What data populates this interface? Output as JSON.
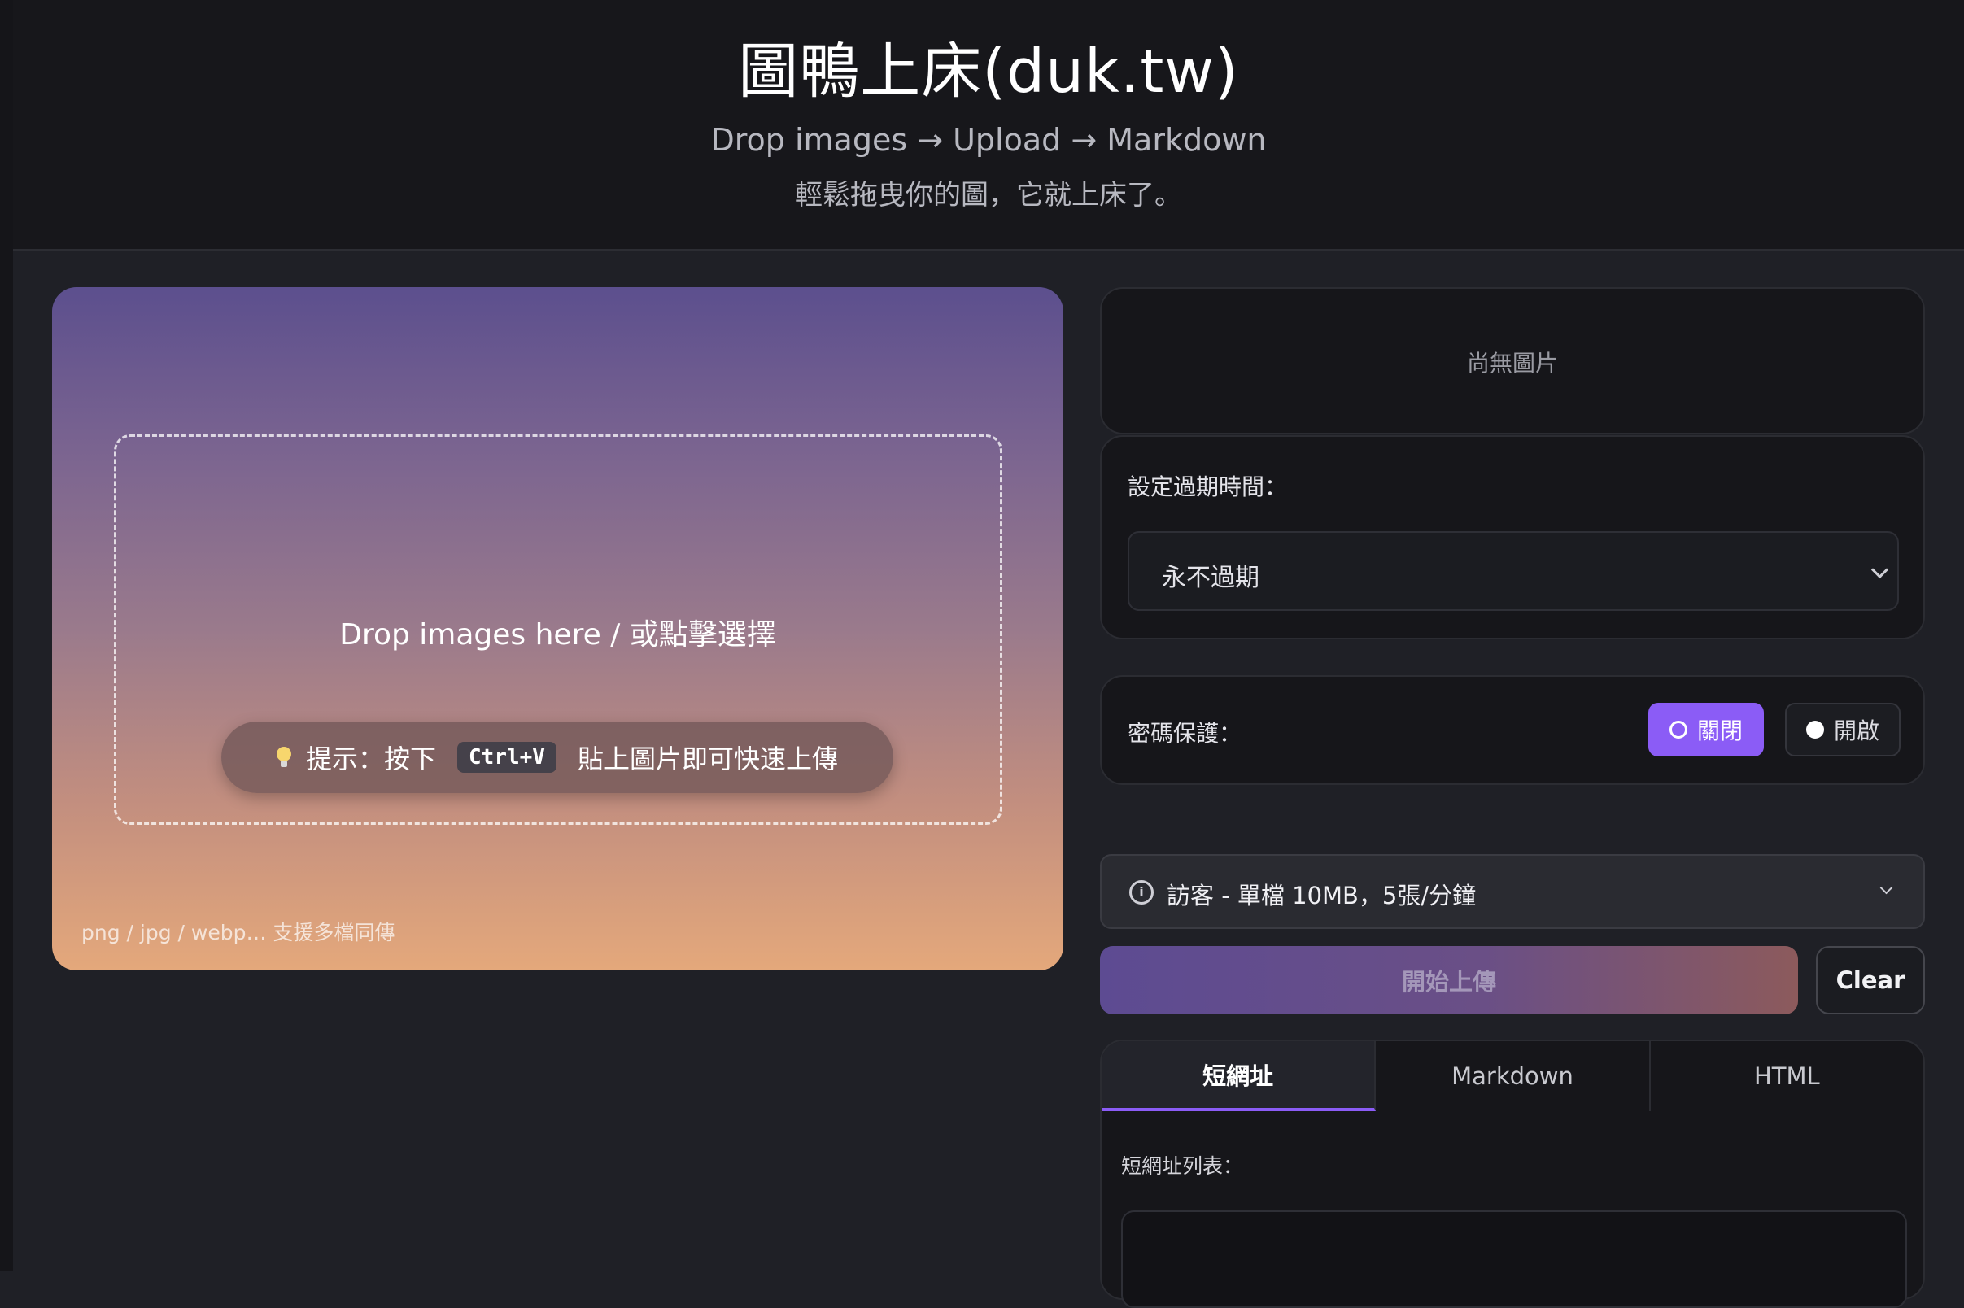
{
  "header": {
    "title": "圖鴨上床(duk.tw)",
    "subtitle": "Drop images → Upload → Markdown",
    "tagline": "輕鬆拖曳你的圖，它就上床了。"
  },
  "dropzone": {
    "main_text": "Drop images here / 或點擊選擇",
    "hint_prefix": "提示：按下",
    "hint_key": "Ctrl+V",
    "hint_suffix": "貼上圖片即可快速上傳",
    "formats": "png / jpg / webp… 支援多檔同傳"
  },
  "preview": {
    "empty_text": "尚無圖片"
  },
  "expiry": {
    "label": "設定過期時間：",
    "selected": "永不過期"
  },
  "password": {
    "label": "密碼保護：",
    "off_label": "關閉",
    "on_label": "開啟"
  },
  "quota": {
    "text": "訪客 - 單檔 10MB，5張/分鐘"
  },
  "actions": {
    "upload_label": "開始上傳",
    "clear_label": "Clear"
  },
  "output": {
    "tabs": [
      "短網址",
      "Markdown",
      "HTML"
    ],
    "list_label": "短網址列表："
  },
  "colors": {
    "accent": "#8b5cf6",
    "gradient_top": "#5c4f8e",
    "gradient_bottom": "#e4a87b"
  }
}
